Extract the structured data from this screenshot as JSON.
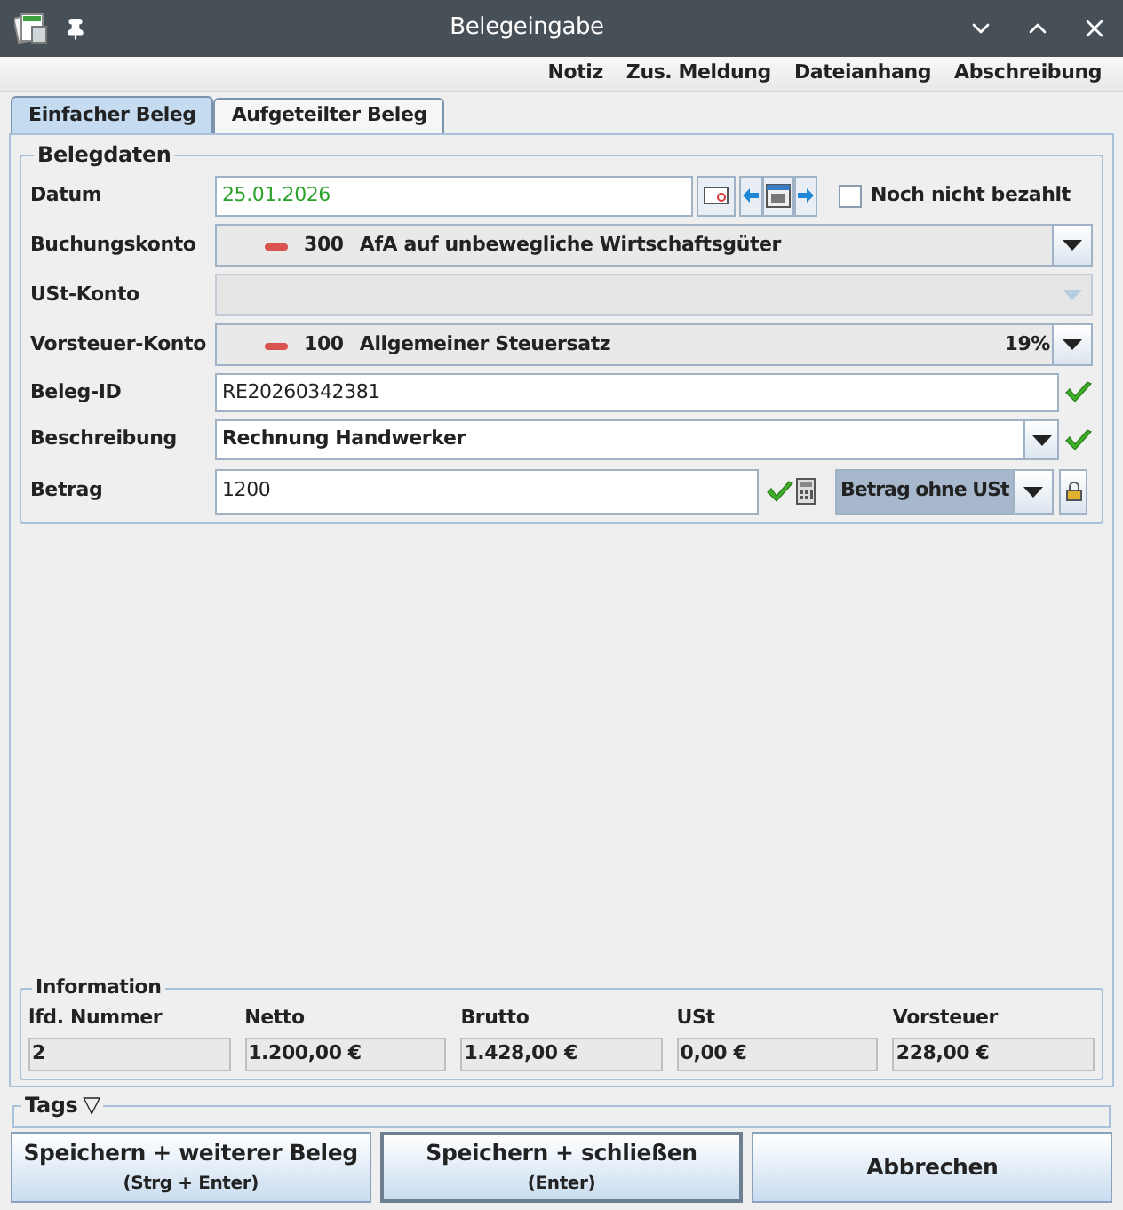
{
  "window": {
    "title": "Belegeingabe"
  },
  "menu": [
    "Notiz",
    "Zus. Meldung",
    "Dateianhang",
    "Abschreibung"
  ],
  "tabs": [
    {
      "label": "Einfacher Beleg",
      "selected": true
    },
    {
      "label": "Aufgeteilter Beleg",
      "selected": false
    }
  ],
  "belegdaten": {
    "title": "Belegdaten",
    "datum": {
      "label": "Datum",
      "value": "25.01.2026"
    },
    "noch_nicht_bezahlt": {
      "label": "Noch nicht bezahlt",
      "checked": false
    },
    "buchungskonto": {
      "label": "Buchungskonto",
      "number": "300",
      "name": "AfA auf unbewegliche Wirtschaftsgüter"
    },
    "ust_konto": {
      "label": "USt-Konto",
      "disabled": true
    },
    "vorsteuer_konto": {
      "label": "Vorsteuer-Konto",
      "number": "100",
      "name": "Allgemeiner Steuersatz",
      "rate": "19%"
    },
    "beleg_id": {
      "label": "Beleg-ID",
      "value": "RE20260342381",
      "valid": true
    },
    "beschreibung": {
      "label": "Beschreibung",
      "value": "Rechnung Handwerker",
      "valid": true
    },
    "betrag": {
      "label": "Betrag",
      "value": "1200",
      "valid": true,
      "mode": "Betrag ohne USt"
    }
  },
  "information": {
    "title": "Information",
    "fields": [
      {
        "label": "lfd. Nummer",
        "value": "2"
      },
      {
        "label": "Netto",
        "value": "1.200,00 €"
      },
      {
        "label": "Brutto",
        "value": "1.428,00 €"
      },
      {
        "label": "USt",
        "value": "0,00 €"
      },
      {
        "label": "Vorsteuer",
        "value": "228,00 €"
      }
    ]
  },
  "tags": {
    "label": "Tags",
    "toggle": "▽"
  },
  "buttons": [
    {
      "label": "Speichern + weiterer Beleg",
      "shortcut": "(Strg + Enter)",
      "default": false
    },
    {
      "label": "Speichern + schließen",
      "shortcut": "(Enter)",
      "default": true
    },
    {
      "label": "Abbrechen",
      "default": false
    }
  ]
}
